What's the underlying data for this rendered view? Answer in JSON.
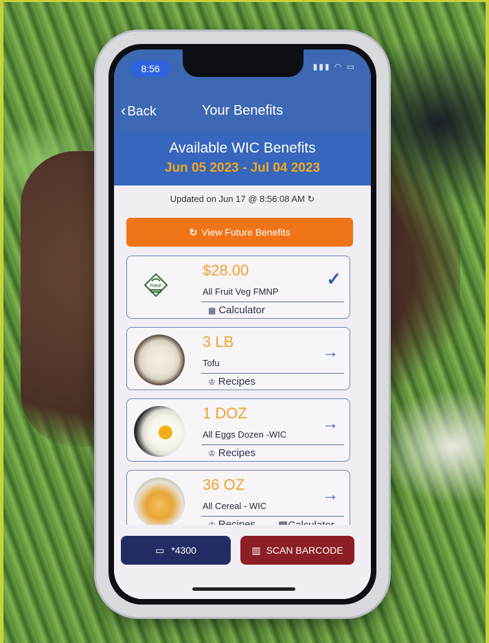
{
  "status_bar": {
    "time": "8:56"
  },
  "nav": {
    "back_label": "Back",
    "title": "Your Benefits"
  },
  "hero": {
    "title": "Available WIC Benefits",
    "dates": "Jun 05 2023 - Jul 04 2023"
  },
  "updated_text": "Updated on Jun 17 @ 8:56:08 AM ↻",
  "future_button_label": "View Future Benefits",
  "benefits": [
    {
      "amount": "$28.00",
      "name": "All Fruit Veg FMNP",
      "action": "Calculator",
      "indicator": "check-icon",
      "logo_text": "FMNP"
    },
    {
      "amount": "3 LB",
      "name": "Tofu",
      "action": "Recipes",
      "indicator": "arrow-right-icon"
    },
    {
      "amount": "1 DOZ",
      "name": "All Eggs Dozen -WIC",
      "action": "Recipes",
      "indicator": "arrow-right-icon"
    },
    {
      "amount": "36 OZ",
      "name": "All Cereal - WIC",
      "action": "Recipes",
      "action2": "Calculator",
      "indicator": "arrow-right-icon"
    }
  ],
  "bottom": {
    "card_label": "*4300",
    "scan_label": "SCAN BARCODE"
  },
  "colors": {
    "header_blue": "#3c68b4",
    "date_orange": "#f2a81d",
    "future_orange": "#ef7417",
    "card_button_navy": "#232d63",
    "scan_button_red": "#8c1e25",
    "amount_orange": "#f0a02a"
  }
}
